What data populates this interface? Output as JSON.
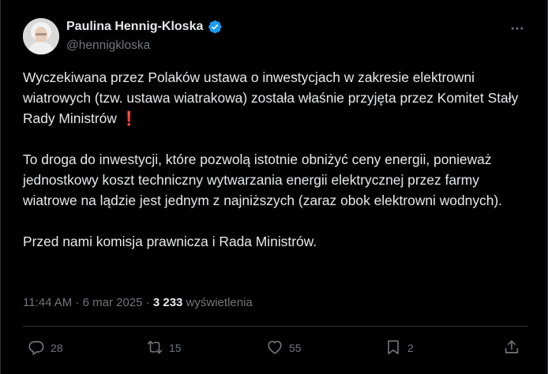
{
  "author": {
    "display_name": "Paulina Hennig-Kloska",
    "handle": "@hennigkloska"
  },
  "tweet": {
    "paragraph1": "Wyczekiwana przez Polaków ustawa o inwestycjach w zakresie elektrowni wiatrowych (tzw. ustawa wiatrakowa) została właśnie przyjęta przez Komitet Stały Rady Ministrów",
    "paragraph1_emoji": "❗",
    "paragraph2": "To droga do inwestycji, które pozwolą istotnie obniżyć ceny energii, ponieważ jednostkowy koszt techniczny wytwarzania energii elektrycznej przez farmy wiatrowe na lądzie jest jednym z najniższych (zaraz obok elektrowni wodnych).",
    "paragraph3": "Przed nami komisja prawnicza i Rada Ministrów."
  },
  "meta": {
    "time": "11:44 AM",
    "separator1": " · ",
    "date": "6 mar 2025",
    "separator2": " · ",
    "views_count": "3 233",
    "views_label": " wyświetlenia"
  },
  "actions": {
    "replies": "28",
    "reposts": "15",
    "likes": "55",
    "bookmarks": "2"
  },
  "colors": {
    "background": "#000000",
    "text": "#e7e9ea",
    "secondary": "#71767b",
    "verified": "#1d9bf0",
    "emoji_red": "#e5213a"
  },
  "icons": [
    "verified-badge-icon",
    "more-icon",
    "reply-icon",
    "repost-icon",
    "like-icon",
    "bookmark-icon",
    "share-icon"
  ]
}
